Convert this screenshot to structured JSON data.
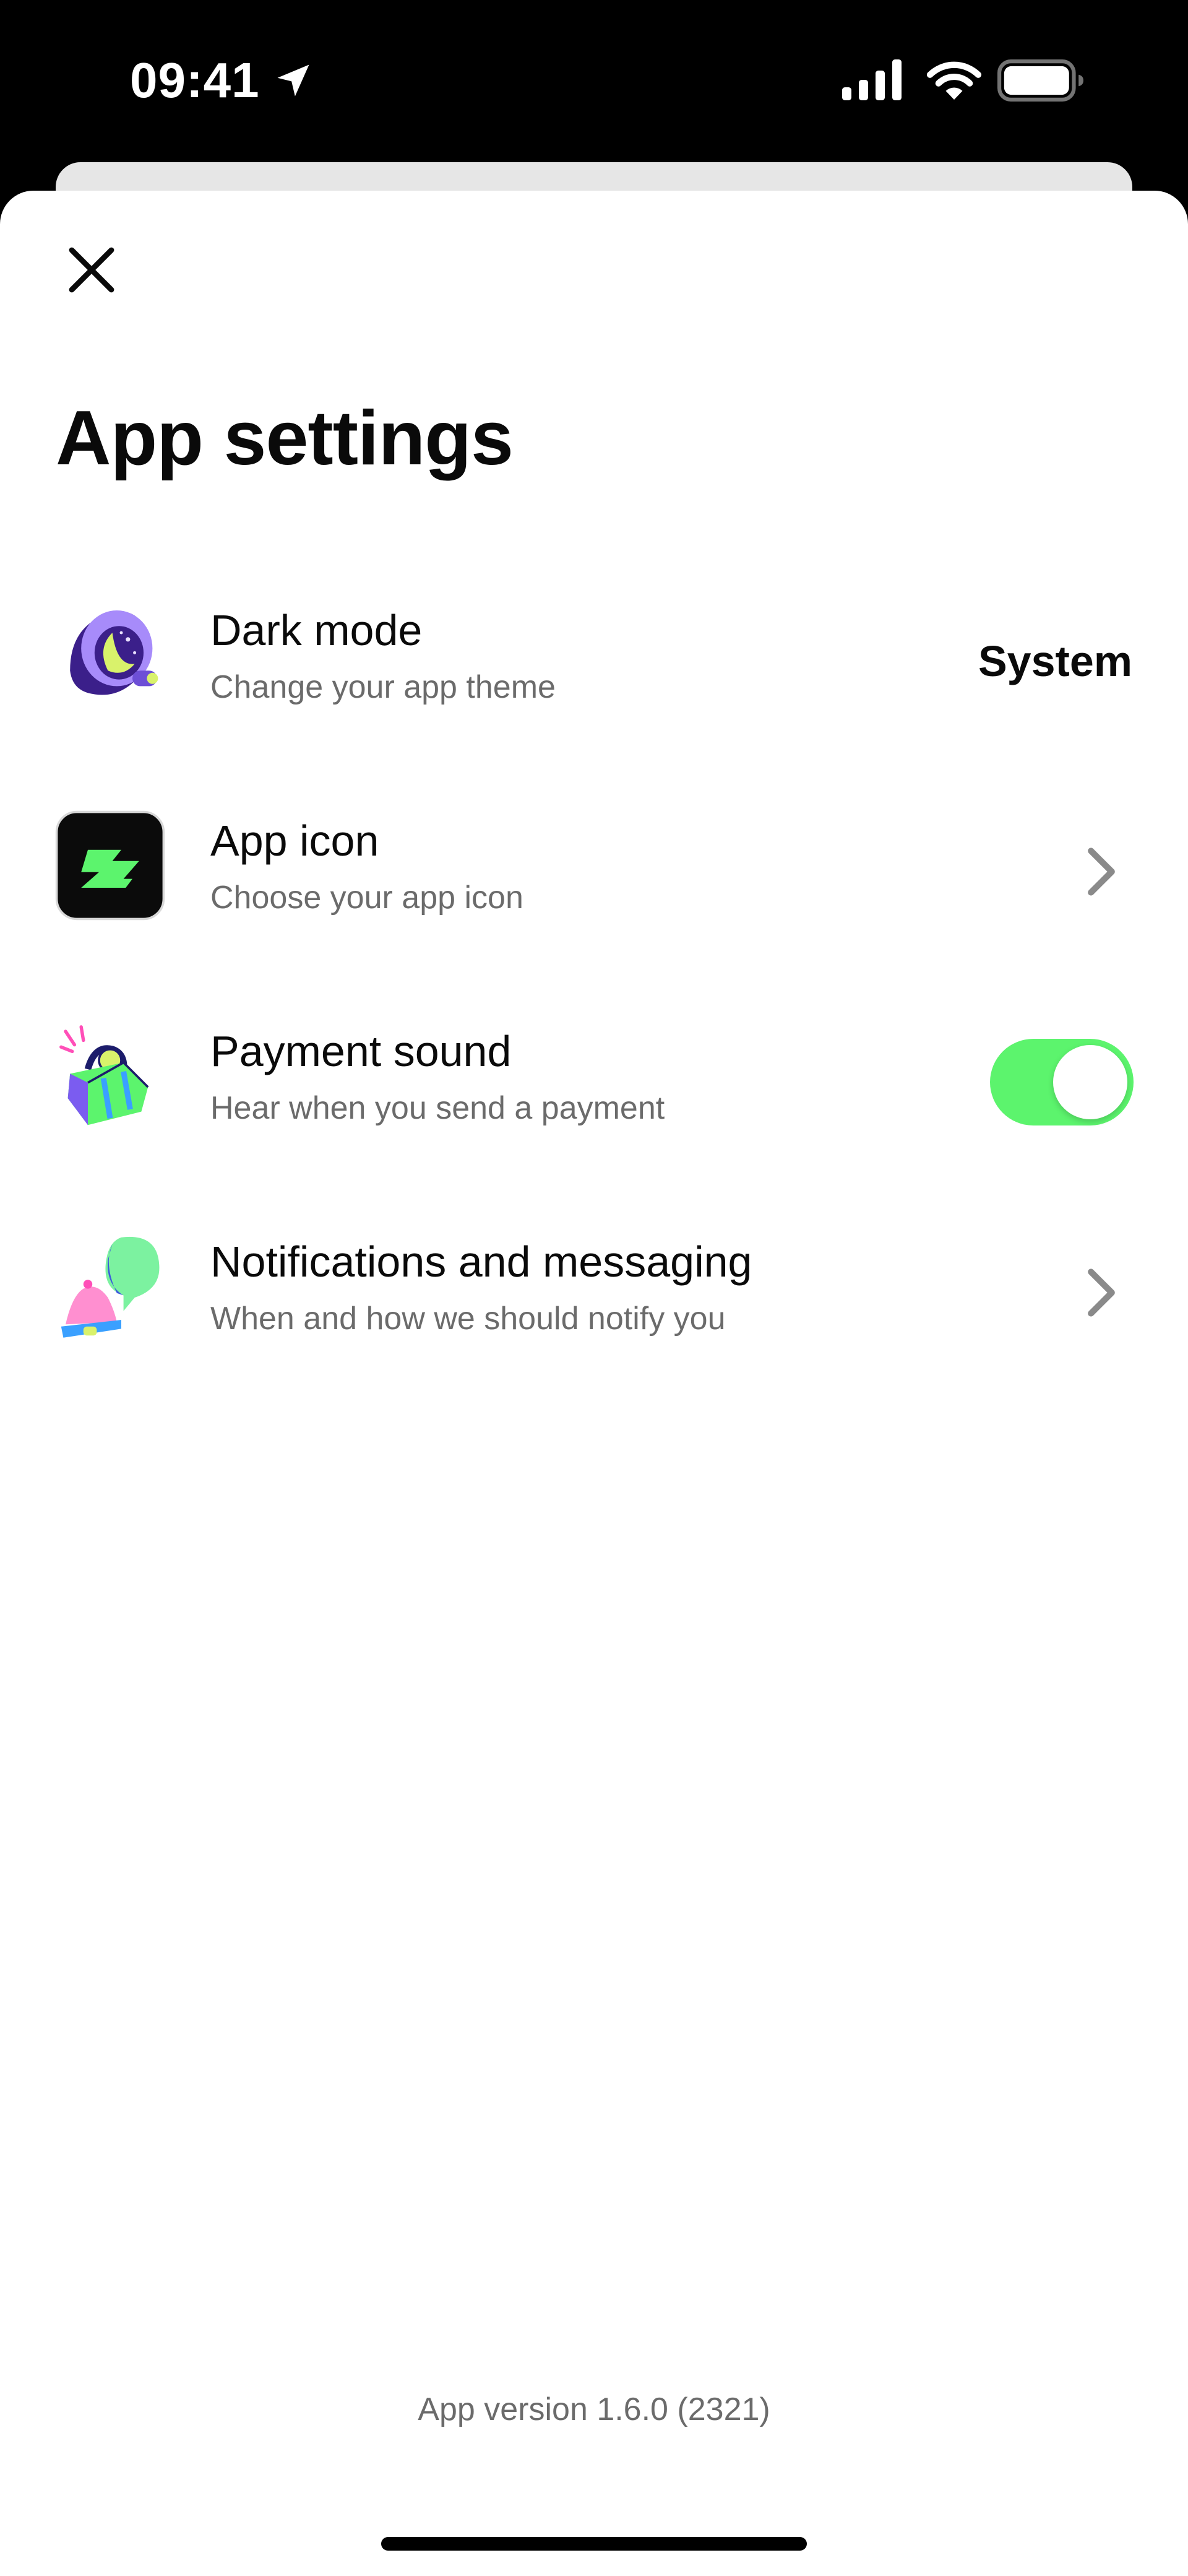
{
  "status_bar": {
    "time": "09:41",
    "icons": [
      "location-arrow-icon",
      "cellular-signal-icon",
      "wifi-icon",
      "battery-icon"
    ]
  },
  "header": {
    "close_icon": "close-icon",
    "title": "App settings"
  },
  "settings": [
    {
      "icon": "moon-theme-icon",
      "title": "Dark mode",
      "subtitle": "Change your app theme",
      "value": "System"
    },
    {
      "icon": "app-icon-preview",
      "title": "App icon",
      "subtitle": "Choose your app icon",
      "accessory": "chevron-right-icon"
    },
    {
      "icon": "shopping-bag-icon",
      "title": "Payment sound",
      "subtitle": "Hear when you send a payment",
      "toggle_on": true
    },
    {
      "icon": "bell-chat-icon",
      "title": "Notifications and messaging",
      "subtitle": "When and how we should notify you",
      "accessory": "chevron-right-icon"
    }
  ],
  "footer": {
    "app_version": "App version 1.6.0 (2321)"
  },
  "colors": {
    "accent_green": "#5cf46d",
    "text_primary": "#0a0a0a",
    "text_secondary": "#6b6b6b",
    "status_bar_bg": "#000000"
  }
}
